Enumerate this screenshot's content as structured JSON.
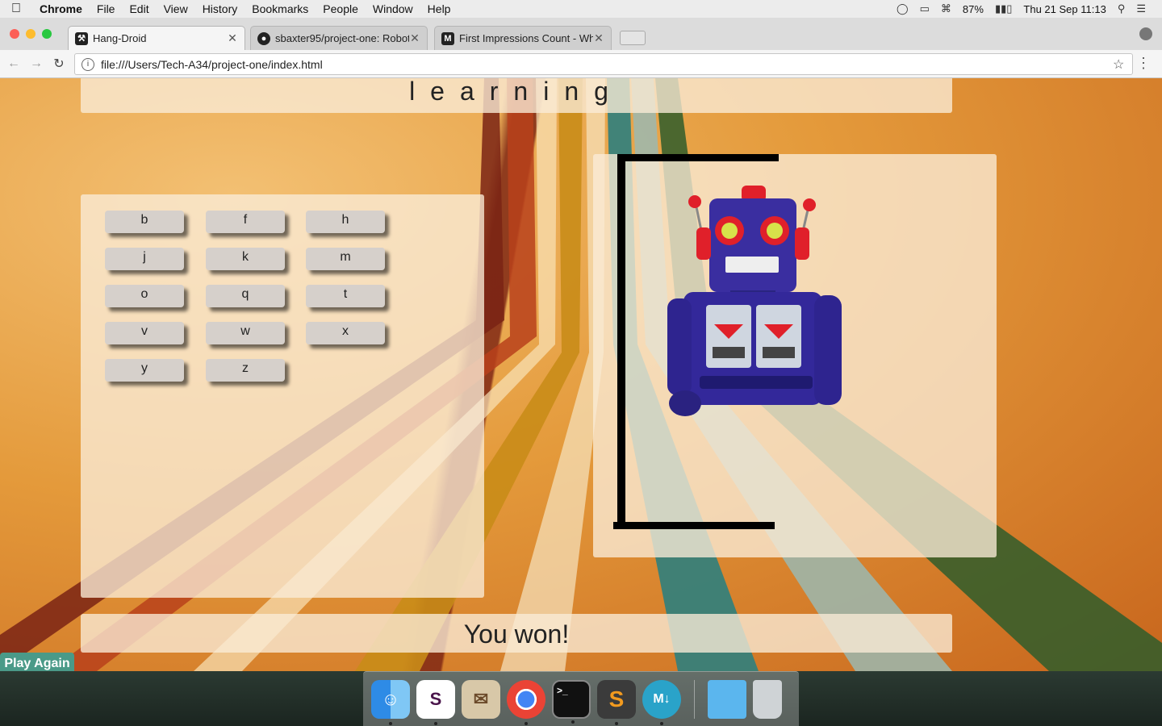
{
  "menubar": {
    "app": "Chrome",
    "items": [
      "File",
      "Edit",
      "View",
      "History",
      "Bookmarks",
      "People",
      "Window",
      "Help"
    ],
    "battery": "87%",
    "clock": "Thu 21 Sep  11:13"
  },
  "tabs": [
    {
      "title": "Hang-Droid",
      "active": true
    },
    {
      "title": "sbaxter95/project-one: Robot",
      "active": false
    },
    {
      "title": "First Impressions Count - Why",
      "active": false
    }
  ],
  "address": {
    "url": "file:///Users/Tech-A34/project-one/index.html"
  },
  "game": {
    "word": "learning",
    "letters": [
      "b",
      "f",
      "h",
      "j",
      "k",
      "m",
      "o",
      "q",
      "t",
      "v",
      "w",
      "x",
      "y",
      "z"
    ],
    "status": "You won!",
    "play_again": "Play Again"
  },
  "dock": {
    "apps": [
      "finder-icon",
      "slack-icon",
      "mail-icon",
      "chrome-icon",
      "terminal-icon",
      "sublime-icon",
      "markdown-icon",
      "folder-icon",
      "trash-icon"
    ]
  },
  "colors": {
    "play_again_bg": "#4a9a88",
    "panel_bg": "#faecd7",
    "key_bg": "#d6d0cb"
  }
}
